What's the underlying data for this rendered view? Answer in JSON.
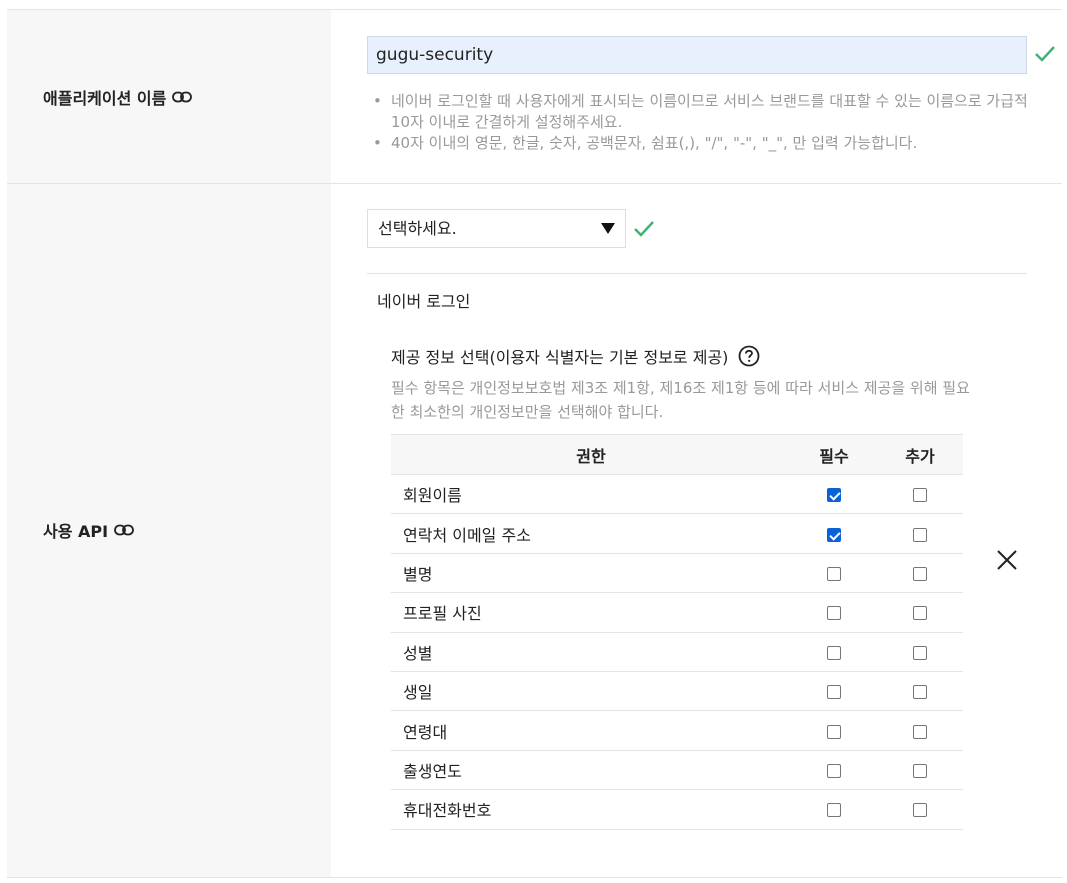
{
  "app_name_row": {
    "label": "애플리케이션 이름",
    "input_value": "gugu-security",
    "hints": [
      "네이버 로그인할 때 사용자에게 표시되는 이름이므로 서비스 브랜드를 대표할 수 있는 이름으로 가급적 10자 이내로 간결하게 설정해주세요.",
      "40자 이내의 영문, 한글, 숫자, 공백문자, 쉼표(,), \"/\", \"-\", \"_\", 만 입력 가능합니다."
    ]
  },
  "api_row": {
    "label": "사용 API",
    "select_value": "선택하세요.",
    "section_title": "네이버 로그인",
    "provide_title": "제공 정보 선택(이용자 식별자는 기본 정보로 제공)",
    "provide_desc": "필수 항목은 개인정보보호법 제3조 제1항, 제16조 제1항 등에 따라 서비스 제공을 위해 필요한 최소한의 개인정보만을 선택해야 합니다.",
    "table": {
      "headers": [
        "권한",
        "필수",
        "추가"
      ],
      "rows": [
        {
          "name": "회원이름",
          "required": true,
          "additional": false
        },
        {
          "name": "연락처 이메일 주소",
          "required": true,
          "additional": false
        },
        {
          "name": "별명",
          "required": false,
          "additional": false
        },
        {
          "name": "프로필 사진",
          "required": false,
          "additional": false
        },
        {
          "name": "성별",
          "required": false,
          "additional": false
        },
        {
          "name": "생일",
          "required": false,
          "additional": false
        },
        {
          "name": "연령대",
          "required": false,
          "additional": false
        },
        {
          "name": "출생연도",
          "required": false,
          "additional": false
        },
        {
          "name": "휴대전화번호",
          "required": false,
          "additional": false
        }
      ]
    }
  },
  "colors": {
    "input_bg": "#e8f0fe",
    "check_green": "#3cb371",
    "checkbox_blue": "#0b62d6",
    "label_bg": "#f7f7f7"
  }
}
